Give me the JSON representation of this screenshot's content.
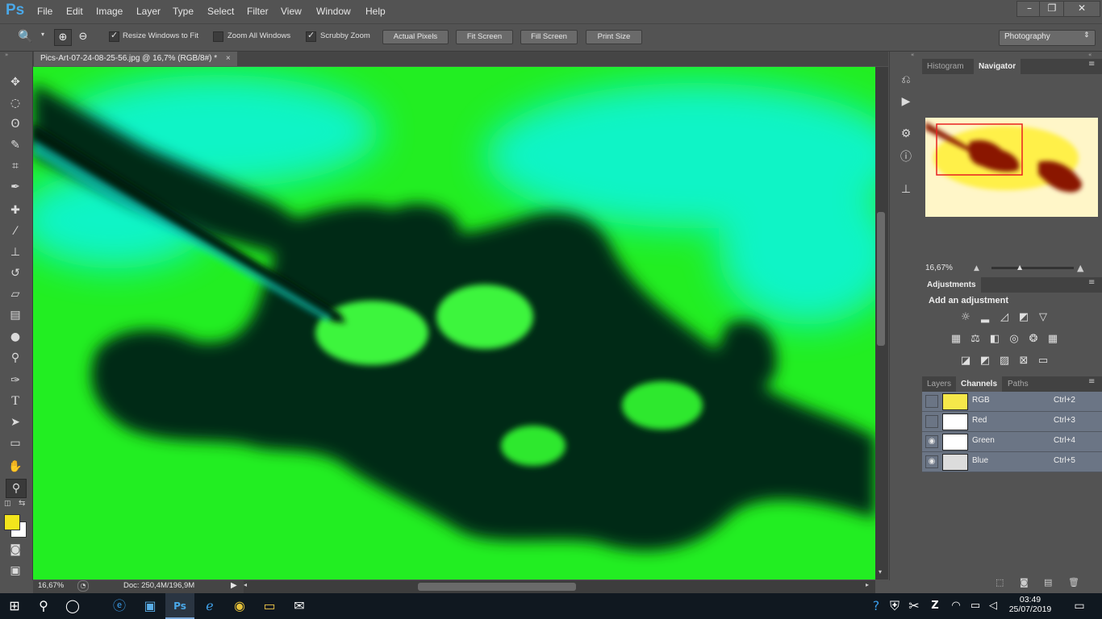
{
  "app": {
    "logo": "Ps"
  },
  "menu": [
    "File",
    "Edit",
    "Image",
    "Layer",
    "Type",
    "Select",
    "Filter",
    "View",
    "Window",
    "Help"
  ],
  "window_controls": {
    "minimize": "–",
    "restore": "❐",
    "close": "✕"
  },
  "options": {
    "resize_windows_label": "Resize Windows to Fit",
    "zoom_all_label": "Zoom All Windows",
    "scrubby_label": "Scrubby Zoom",
    "actual_pixels": "Actual Pixels",
    "fit_screen": "Fit Screen",
    "fill_screen": "Fill Screen",
    "print_size": "Print Size",
    "workspace": "Photography",
    "resize_windows_checked": true,
    "zoom_all_checked": false,
    "scrubby_checked": true
  },
  "document": {
    "tab_title": "Pics-Art-07-24-08-25-56.jpg @ 16,7% (RGB/8#) *",
    "close": "×",
    "zoom": "16,67%",
    "doc_info": "Doc: 250,4M/196,9M"
  },
  "tools": [
    "move-tool",
    "marquee-tool",
    "lasso-tool",
    "quick-select-tool",
    "crop-tool",
    "eyedropper-tool",
    "healing-brush-tool",
    "brush-tool",
    "clone-stamp-tool",
    "history-brush-tool",
    "eraser-tool",
    "gradient-tool",
    "blur-tool",
    "dodge-tool",
    "pen-tool",
    "type-tool",
    "path-select-tool",
    "shape-tool",
    "hand-tool",
    "zoom-tool"
  ],
  "colors": {
    "foreground": "#f3e51c",
    "background": "#ffffff",
    "canvas_green": "#22ee22",
    "canvas_cyan": "#11f5d8",
    "navigator_box": "#e82020"
  },
  "navigator": {
    "tab_histogram": "Histogram",
    "tab_navigator": "Navigator",
    "zoom": "16,67%"
  },
  "adjustments": {
    "tab": "Adjustments",
    "heading": "Add an adjustment"
  },
  "layers_panel": {
    "tabs": [
      "Layers",
      "Channels",
      "Paths"
    ],
    "active_tab": "Channels",
    "channels": [
      {
        "name": "RGB",
        "shortcut": "Ctrl+2",
        "visible": false
      },
      {
        "name": "Red",
        "shortcut": "Ctrl+3",
        "visible": false
      },
      {
        "name": "Green",
        "shortcut": "Ctrl+4",
        "visible": true
      },
      {
        "name": "Blue",
        "shortcut": "Ctrl+5",
        "visible": true
      }
    ]
  },
  "taskbar": {
    "time": "03:49",
    "date": "25/07/2019",
    "apps": [
      "start-button",
      "search-button",
      "task-view-button",
      "edge-app",
      "store-app",
      "photoshop-app",
      "ie-app",
      "chrome-app",
      "explorer-app",
      "mail-app"
    ]
  }
}
